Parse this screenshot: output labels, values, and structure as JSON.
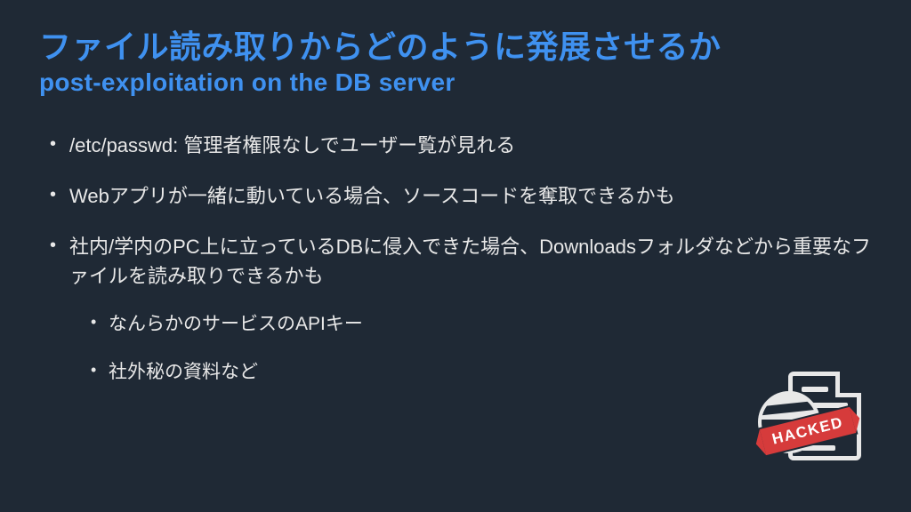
{
  "slide": {
    "title": "ファイル読み取りからどのように発展させるか",
    "subtitle": "post-exploitation on the DB server",
    "bullets": [
      {
        "text": "/etc/passwd: 管理者権限なしでユーザー覧が見れる"
      },
      {
        "text": "Webアプリが一緒に動いている場合、ソースコードを奪取できるかも"
      },
      {
        "text": "社内/学内のPC上に立っているDBに侵入できた場合、Downloadsフォルダなどから重要なファイルを読み取りできるかも",
        "sub": [
          {
            "text": "なんらかのサービスのAPIキー"
          },
          {
            "text": "社外秘の資料など"
          }
        ]
      }
    ],
    "badge_label": "HACKED"
  }
}
